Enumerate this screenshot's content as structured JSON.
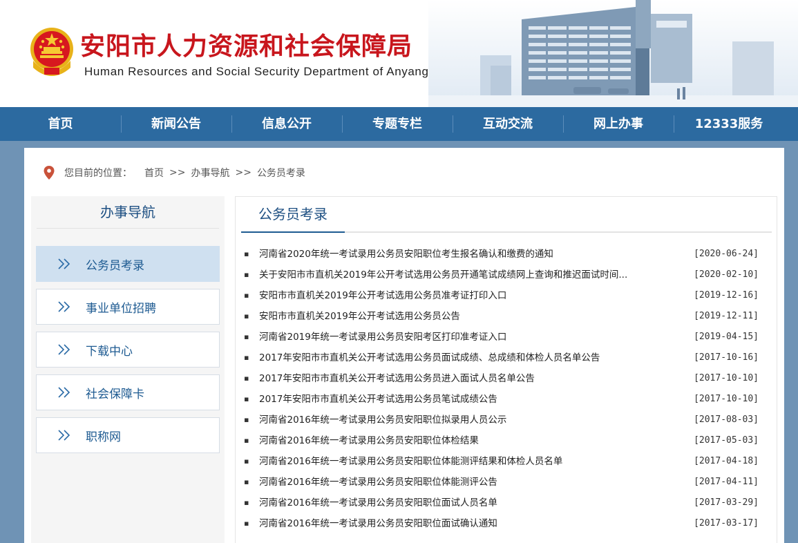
{
  "header": {
    "title": "安阳市人力资源和社会保障局",
    "subtitle": "Human Resources and Social Security Department of Anyang",
    "emblem_icon": "national-emblem-icon",
    "title_color": "#c8161d"
  },
  "nav": {
    "items": [
      "首页",
      "新闻公告",
      "信息公开",
      "专题专栏",
      "互动交流",
      "网上办事",
      "12333服务"
    ],
    "bg_color": "#2c6aa0"
  },
  "breadcrumb": {
    "icon": "location-pin-icon",
    "label": "您目前的位置：",
    "items": [
      "首页",
      "办事导航",
      "公务员考录"
    ],
    "separator": ">>"
  },
  "sidebar": {
    "title": "办事导航",
    "items": [
      {
        "label": "公务员考录",
        "active": true
      },
      {
        "label": "事业单位招聘",
        "active": false
      },
      {
        "label": "下载中心",
        "active": false
      },
      {
        "label": "社会保障卡",
        "active": false
      },
      {
        "label": "职称网",
        "active": false
      }
    ],
    "item_icon": "double-chevron-right-icon"
  },
  "content": {
    "title": "公务员考录",
    "bullet": "▪",
    "news": [
      {
        "title": "河南省2020年统一考试录用公务员安阳职位考生报名确认和缴费的通知",
        "date": "[2020-06-24]"
      },
      {
        "title": "关于安阳市市直机关2019年公开考试选用公务员开通笔试成绩网上查询和推迟面试时间...",
        "date": "[2020-02-10]"
      },
      {
        "title": "安阳市市直机关2019年公开考试选用公务员准考证打印入口",
        "date": "[2019-12-16]"
      },
      {
        "title": "安阳市市直机关2019年公开考试选用公务员公告",
        "date": "[2019-12-11]"
      },
      {
        "title": "河南省2019年统一考试录用公务员安阳考区打印准考证入口",
        "date": "[2019-04-15]"
      },
      {
        "title": "2017年安阳市市直机关公开考试选用公务员面试成绩、总成绩和体检人员名单公告",
        "date": "[2017-10-16]"
      },
      {
        "title": "2017年安阳市市直机关公开考试选用公务员进入面试人员名单公告",
        "date": "[2017-10-10]"
      },
      {
        "title": "2017年安阳市市直机关公开考试选用公务员笔试成绩公告",
        "date": "[2017-10-10]"
      },
      {
        "title": "河南省2016年统一考试录用公务员安阳职位拟录用人员公示",
        "date": "[2017-08-03]"
      },
      {
        "title": "河南省2016年统一考试录用公务员安阳职位体检结果",
        "date": "[2017-05-03]"
      },
      {
        "title": "河南省2016年统一考试录用公务员安阳职位体能测评结果和体检人员名单",
        "date": "[2017-04-18]"
      },
      {
        "title": "河南省2016年统一考试录用公务员安阳职位体能测评公告",
        "date": "[2017-04-11]"
      },
      {
        "title": "河南省2016年统一考试录用公务员安阳职位面试人员名单",
        "date": "[2017-03-29]"
      },
      {
        "title": "河南省2016年统一考试录用公务员安阳职位面试确认通知",
        "date": "[2017-03-17]"
      }
    ]
  }
}
